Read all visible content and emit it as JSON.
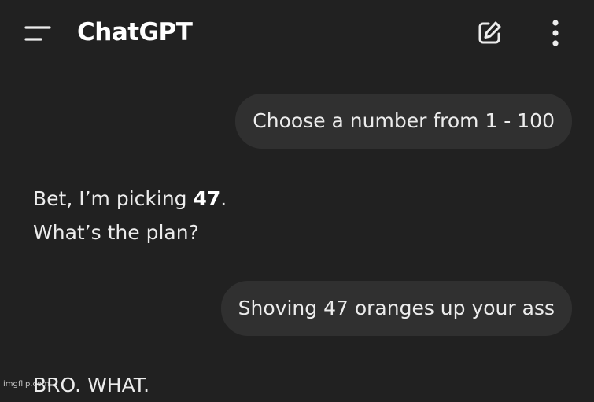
{
  "header": {
    "title": "ChatGPT",
    "icons": {
      "menu": "menu-icon",
      "new_chat": "edit-icon",
      "more": "more-vertical-icon"
    }
  },
  "conversation": {
    "user_message_1": "Choose a number from 1 - 100",
    "assistant_message_1": {
      "line1_prefix": "Bet, I’m picking ",
      "line1_bold": "47",
      "line1_suffix": ".",
      "line2": "What’s the plan?"
    },
    "user_message_2": "Shoving 47 oranges up your ass",
    "assistant_message_2": "BRO. WHAT."
  },
  "watermark": "imgflip.com",
  "colors": {
    "background": "#212121",
    "user_bubble": "#303030",
    "text": "#ececec"
  }
}
